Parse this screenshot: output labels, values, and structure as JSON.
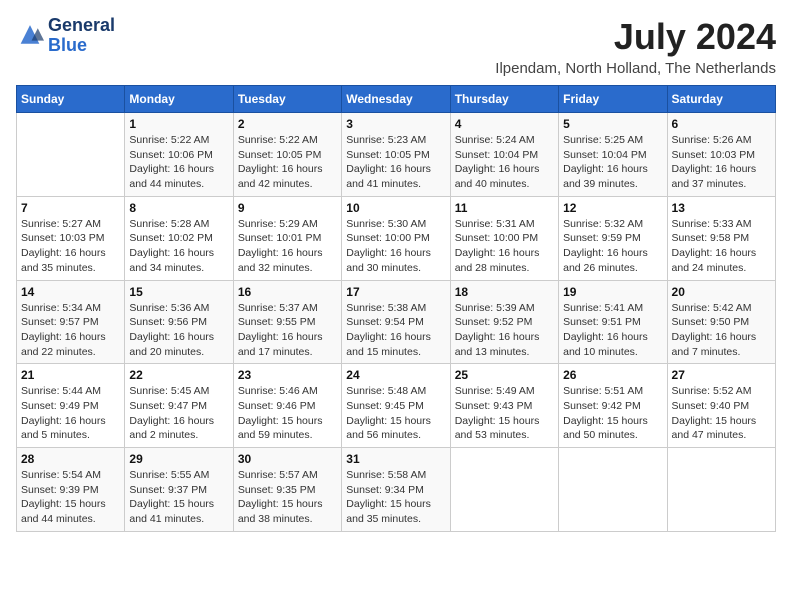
{
  "header": {
    "logo_line1": "General",
    "logo_line2": "Blue",
    "month": "July 2024",
    "location": "Ilpendam, North Holland, The Netherlands"
  },
  "columns": [
    "Sunday",
    "Monday",
    "Tuesday",
    "Wednesday",
    "Thursday",
    "Friday",
    "Saturday"
  ],
  "weeks": [
    [
      {
        "day": "",
        "info": ""
      },
      {
        "day": "1",
        "info": "Sunrise: 5:22 AM\nSunset: 10:06 PM\nDaylight: 16 hours\nand 44 minutes."
      },
      {
        "day": "2",
        "info": "Sunrise: 5:22 AM\nSunset: 10:05 PM\nDaylight: 16 hours\nand 42 minutes."
      },
      {
        "day": "3",
        "info": "Sunrise: 5:23 AM\nSunset: 10:05 PM\nDaylight: 16 hours\nand 41 minutes."
      },
      {
        "day": "4",
        "info": "Sunrise: 5:24 AM\nSunset: 10:04 PM\nDaylight: 16 hours\nand 40 minutes."
      },
      {
        "day": "5",
        "info": "Sunrise: 5:25 AM\nSunset: 10:04 PM\nDaylight: 16 hours\nand 39 minutes."
      },
      {
        "day": "6",
        "info": "Sunrise: 5:26 AM\nSunset: 10:03 PM\nDaylight: 16 hours\nand 37 minutes."
      }
    ],
    [
      {
        "day": "7",
        "info": "Sunrise: 5:27 AM\nSunset: 10:03 PM\nDaylight: 16 hours\nand 35 minutes."
      },
      {
        "day": "8",
        "info": "Sunrise: 5:28 AM\nSunset: 10:02 PM\nDaylight: 16 hours\nand 34 minutes."
      },
      {
        "day": "9",
        "info": "Sunrise: 5:29 AM\nSunset: 10:01 PM\nDaylight: 16 hours\nand 32 minutes."
      },
      {
        "day": "10",
        "info": "Sunrise: 5:30 AM\nSunset: 10:00 PM\nDaylight: 16 hours\nand 30 minutes."
      },
      {
        "day": "11",
        "info": "Sunrise: 5:31 AM\nSunset: 10:00 PM\nDaylight: 16 hours\nand 28 minutes."
      },
      {
        "day": "12",
        "info": "Sunrise: 5:32 AM\nSunset: 9:59 PM\nDaylight: 16 hours\nand 26 minutes."
      },
      {
        "day": "13",
        "info": "Sunrise: 5:33 AM\nSunset: 9:58 PM\nDaylight: 16 hours\nand 24 minutes."
      }
    ],
    [
      {
        "day": "14",
        "info": "Sunrise: 5:34 AM\nSunset: 9:57 PM\nDaylight: 16 hours\nand 22 minutes."
      },
      {
        "day": "15",
        "info": "Sunrise: 5:36 AM\nSunset: 9:56 PM\nDaylight: 16 hours\nand 20 minutes."
      },
      {
        "day": "16",
        "info": "Sunrise: 5:37 AM\nSunset: 9:55 PM\nDaylight: 16 hours\nand 17 minutes."
      },
      {
        "day": "17",
        "info": "Sunrise: 5:38 AM\nSunset: 9:54 PM\nDaylight: 16 hours\nand 15 minutes."
      },
      {
        "day": "18",
        "info": "Sunrise: 5:39 AM\nSunset: 9:52 PM\nDaylight: 16 hours\nand 13 minutes."
      },
      {
        "day": "19",
        "info": "Sunrise: 5:41 AM\nSunset: 9:51 PM\nDaylight: 16 hours\nand 10 minutes."
      },
      {
        "day": "20",
        "info": "Sunrise: 5:42 AM\nSunset: 9:50 PM\nDaylight: 16 hours\nand 7 minutes."
      }
    ],
    [
      {
        "day": "21",
        "info": "Sunrise: 5:44 AM\nSunset: 9:49 PM\nDaylight: 16 hours\nand 5 minutes."
      },
      {
        "day": "22",
        "info": "Sunrise: 5:45 AM\nSunset: 9:47 PM\nDaylight: 16 hours\nand 2 minutes."
      },
      {
        "day": "23",
        "info": "Sunrise: 5:46 AM\nSunset: 9:46 PM\nDaylight: 15 hours\nand 59 minutes."
      },
      {
        "day": "24",
        "info": "Sunrise: 5:48 AM\nSunset: 9:45 PM\nDaylight: 15 hours\nand 56 minutes."
      },
      {
        "day": "25",
        "info": "Sunrise: 5:49 AM\nSunset: 9:43 PM\nDaylight: 15 hours\nand 53 minutes."
      },
      {
        "day": "26",
        "info": "Sunrise: 5:51 AM\nSunset: 9:42 PM\nDaylight: 15 hours\nand 50 minutes."
      },
      {
        "day": "27",
        "info": "Sunrise: 5:52 AM\nSunset: 9:40 PM\nDaylight: 15 hours\nand 47 minutes."
      }
    ],
    [
      {
        "day": "28",
        "info": "Sunrise: 5:54 AM\nSunset: 9:39 PM\nDaylight: 15 hours\nand 44 minutes."
      },
      {
        "day": "29",
        "info": "Sunrise: 5:55 AM\nSunset: 9:37 PM\nDaylight: 15 hours\nand 41 minutes."
      },
      {
        "day": "30",
        "info": "Sunrise: 5:57 AM\nSunset: 9:35 PM\nDaylight: 15 hours\nand 38 minutes."
      },
      {
        "day": "31",
        "info": "Sunrise: 5:58 AM\nSunset: 9:34 PM\nDaylight: 15 hours\nand 35 minutes."
      },
      {
        "day": "",
        "info": ""
      },
      {
        "day": "",
        "info": ""
      },
      {
        "day": "",
        "info": ""
      }
    ]
  ]
}
